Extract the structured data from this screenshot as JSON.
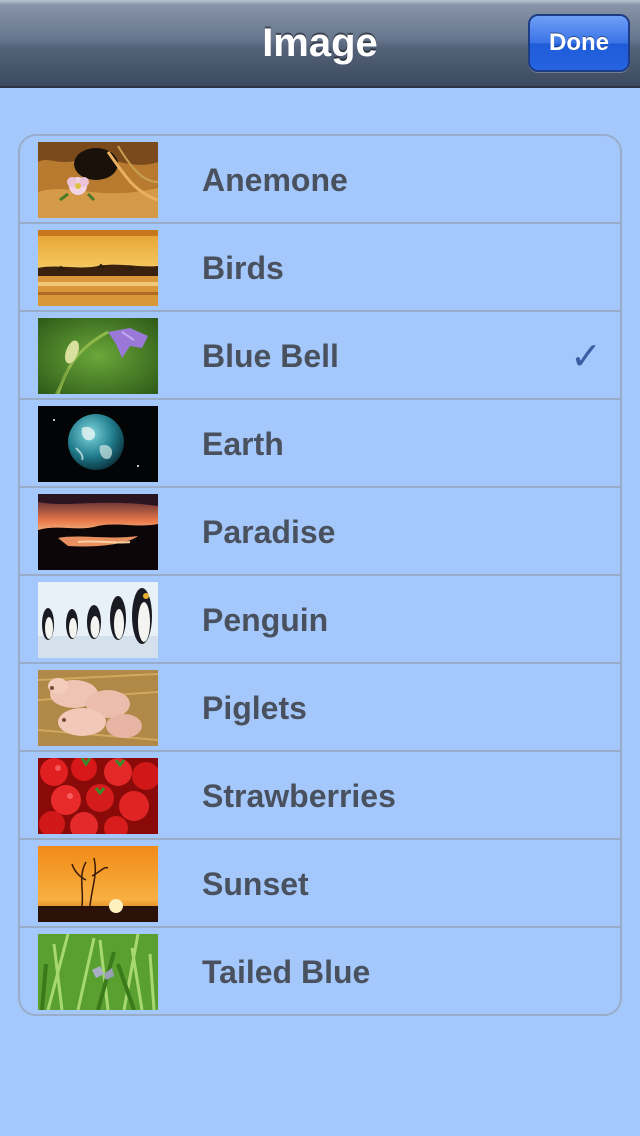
{
  "navbar": {
    "title": "Image",
    "done_label": "Done"
  },
  "images": [
    {
      "label": "Anemone",
      "selected": false
    },
    {
      "label": "Birds",
      "selected": false
    },
    {
      "label": "Blue Bell",
      "selected": true
    },
    {
      "label": "Earth",
      "selected": false
    },
    {
      "label": "Paradise",
      "selected": false
    },
    {
      "label": "Penguin",
      "selected": false
    },
    {
      "label": "Piglets",
      "selected": false
    },
    {
      "label": "Strawberries",
      "selected": false
    },
    {
      "label": "Sunset",
      "selected": false
    },
    {
      "label": "Tailed Blue",
      "selected": false
    }
  ],
  "checkmark_icon": "checkmark-icon",
  "colors": {
    "background": "#a5c8fc",
    "separator": "#97adc9",
    "label": "#4a515e",
    "checkmark": "#3a5ea4",
    "done_button": "#2563e2"
  }
}
